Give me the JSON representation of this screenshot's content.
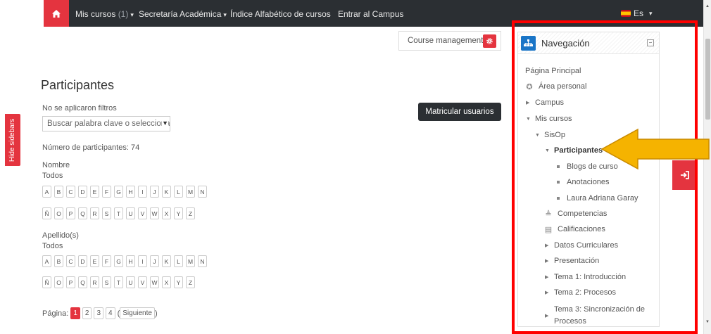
{
  "navbar": {
    "items": [
      {
        "label": "Mis cursos",
        "count": "(1)"
      },
      {
        "label": "Secretaría Académica"
      },
      {
        "label": "Índice Alfabético de cursos"
      },
      {
        "label": "Entrar al Campus"
      }
    ],
    "language": "Es"
  },
  "sidebar_toggle": "Hide sidebars",
  "course_management": "Course management",
  "main": {
    "title": "Participantes",
    "filters_text": "No se aplicaron filtros",
    "search_placeholder": "Buscar palabra clave o seleccionar filtro",
    "enrol_button": "Matricular usuarios",
    "participant_count": "Número de participantes: 74",
    "first_name_label": "Nombre",
    "last_name_label": "Apellido(s)",
    "all_label": "Todos",
    "letters_row1": [
      "A",
      "B",
      "C",
      "D",
      "E",
      "F",
      "G",
      "H",
      "I",
      "J",
      "K",
      "L",
      "M",
      "N"
    ],
    "letters_row2": [
      "Ñ",
      "O",
      "P",
      "Q",
      "R",
      "S",
      "T",
      "U",
      "V",
      "W",
      "X",
      "Y",
      "Z"
    ],
    "pager": {
      "label": "Página:",
      "pages": [
        "1",
        "2",
        "3",
        "4"
      ],
      "active_page": "1",
      "next": "Siguiente"
    }
  },
  "navigation": {
    "title": "Navegación",
    "items": [
      {
        "label": "Página Principal"
      },
      {
        "label": "Área personal"
      },
      {
        "label": "Campus"
      },
      {
        "label": "Mis cursos"
      },
      {
        "label": "SisOp"
      },
      {
        "label": "Participantes"
      },
      {
        "label": "Blogs de curso"
      },
      {
        "label": "Anotaciones"
      },
      {
        "label": "Laura Adriana Garay"
      },
      {
        "label": "Competencias"
      },
      {
        "label": "Calificaciones"
      },
      {
        "label": "Datos Curriculares"
      },
      {
        "label": "Presentación"
      },
      {
        "label": "Tema 1: Introducción"
      },
      {
        "label": "Tema 2: Procesos"
      },
      {
        "label": "Tema 3: Sincronización de Procesos"
      }
    ]
  },
  "colors": {
    "accent": "#e4343f",
    "navbar": "#2b2f33",
    "highlight_frame": "#ff0000",
    "arrow": "#f5b300",
    "nav_icon": "#1a75c7"
  }
}
